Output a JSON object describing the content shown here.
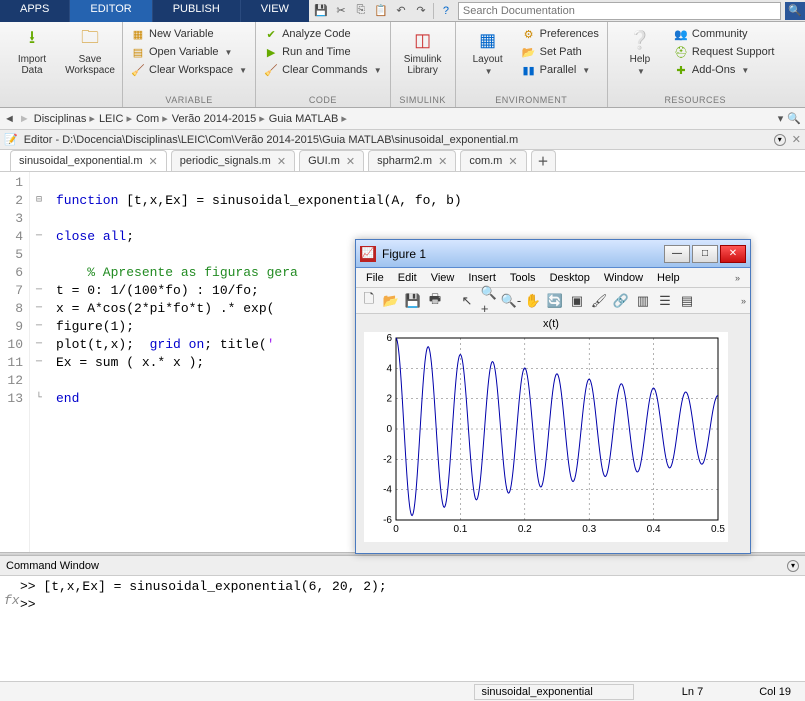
{
  "ribbon": {
    "tabs": [
      "APPS",
      "EDITOR",
      "PUBLISH",
      "VIEW"
    ]
  },
  "search": {
    "placeholder": "Search Documentation"
  },
  "toolgroups": {
    "file": {
      "label": "",
      "import": "Import\nData",
      "save": "Save\nWorkspace"
    },
    "variable": {
      "label": "VARIABLE",
      "new": "New Variable",
      "open": "Open Variable",
      "clear": "Clear Workspace"
    },
    "code": {
      "label": "CODE",
      "analyze": "Analyze Code",
      "run": "Run and Time",
      "clear": "Clear Commands"
    },
    "simulink": {
      "label": "SIMULINK",
      "lib": "Simulink\nLibrary"
    },
    "environment": {
      "label": "ENVIRONMENT",
      "layout": "Layout",
      "prefs": "Preferences",
      "setpath": "Set Path",
      "parallel": "Parallel"
    },
    "resources": {
      "label": "RESOURCES",
      "help": "Help",
      "community": "Community",
      "support": "Request Support",
      "addons": "Add-Ons"
    }
  },
  "breadcrumb": [
    "Disciplinas",
    "LEIC",
    "Com",
    "Verão 2014-2015",
    "Guia MATLAB"
  ],
  "editor": {
    "title": "Editor - D:\\Docencia\\Disciplinas\\LEIC\\Com\\Verão 2014-2015\\Guia MATLAB\\sinusoidal_exponential.m",
    "tabs": [
      "sinusoidal_exponential.m",
      "periodic_signals.m",
      "GUI.m",
      "spharm2.m",
      "com.m"
    ]
  },
  "code_lines": [
    "",
    "function [t,x,Ex] = sinusoidal_exponential(A, fo, b)",
    "",
    "close all;",
    "",
    "    % Apresente as figuras gera",
    "t = 0: 1/(100*fo) : 10/fo;",
    "x = A*cos(2*pi*fo*t) .* exp(",
    "figure(1);",
    "plot(t,x);  grid on; title('",
    "Ex = sum ( x.* x );",
    "",
    "end"
  ],
  "command": {
    "title": "Command Window",
    "lines": [
      ">> [t,x,Ex] = sinusoidal_exponential(6, 20, 2);",
      ">>"
    ]
  },
  "status": {
    "file": "sinusoidal_exponential",
    "ln": "Ln  7",
    "col": "Col  19"
  },
  "figure": {
    "title": "Figure 1",
    "menu": [
      "File",
      "Edit",
      "View",
      "Insert",
      "Tools",
      "Desktop",
      "Window",
      "Help"
    ]
  },
  "chart_data": {
    "type": "line",
    "title": "x(t)",
    "xlabel": "",
    "ylabel": "",
    "xlim": [
      0,
      0.5
    ],
    "ylim": [
      -6,
      6
    ],
    "xticks": [
      0,
      0.1,
      0.2,
      0.3,
      0.4,
      0.5
    ],
    "yticks": [
      -6,
      -4,
      -2,
      0,
      2,
      4,
      6
    ],
    "params": {
      "A": 6,
      "fo": 20,
      "b": 2
    },
    "note": "x(t) = A·cos(2π·fo·t)·exp(-b·t), sampled at 1/(100·fo), so values are implicit from params"
  }
}
